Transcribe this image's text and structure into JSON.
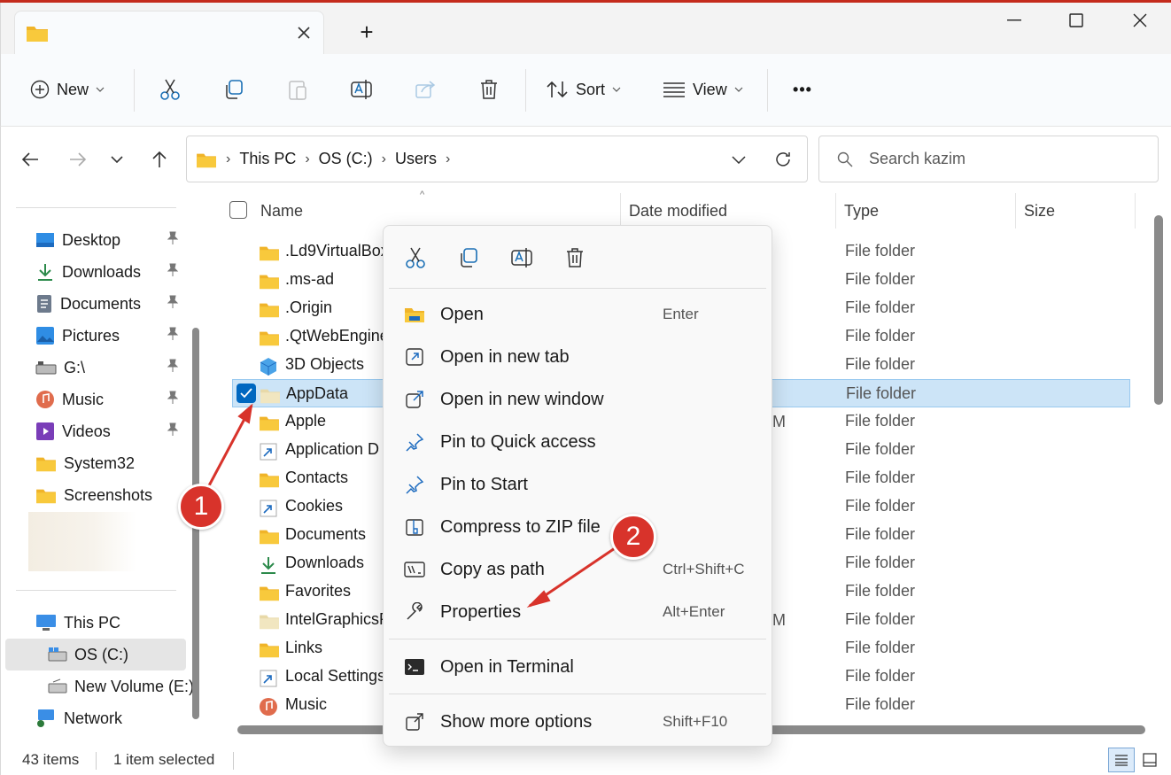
{
  "window": {
    "new_tab_symbol": "+"
  },
  "toolbar": {
    "new_label": "New",
    "sort_label": "Sort",
    "view_label": "View",
    "more_label": "•••"
  },
  "address": {
    "crumbs": [
      "This PC",
      "OS (C:)",
      "Users"
    ]
  },
  "search": {
    "placeholder": "Search kazim"
  },
  "nav": {
    "quick": [
      "Desktop",
      "Downloads",
      "Documents",
      "Pictures",
      "G:\\",
      "Music",
      "Videos",
      "System32",
      "Screenshots"
    ],
    "this_pc": "This PC",
    "drives": [
      "OS (C:)",
      "New Volume (E:)"
    ],
    "network": "Network"
  },
  "columns": {
    "name": "Name",
    "date": "Date modified",
    "type": "Type",
    "size": "Size"
  },
  "files": [
    {
      "name": ".Ld9VirtualBox",
      "type": "File folder"
    },
    {
      "name": ".ms-ad",
      "type": "File folder"
    },
    {
      "name": ".Origin",
      "type": "File folder"
    },
    {
      "name": ".QtWebEngine",
      "type": "File folder"
    },
    {
      "name": "3D Objects",
      "type": "File folder"
    },
    {
      "name": "AppData",
      "type": "File folder"
    },
    {
      "name": "Apple",
      "type": "File folder"
    },
    {
      "name": "Application D",
      "type": "File folder"
    },
    {
      "name": "Contacts",
      "type": "File folder"
    },
    {
      "name": "Cookies",
      "type": "File folder"
    },
    {
      "name": "Documents",
      "type": "File folder"
    },
    {
      "name": "Downloads",
      "type": "File folder"
    },
    {
      "name": "Favorites",
      "type": "File folder"
    },
    {
      "name": "IntelGraphicsP",
      "type": "File folder"
    },
    {
      "name": "Links",
      "type": "File folder"
    },
    {
      "name": "Local Settings",
      "type": "File folder"
    },
    {
      "name": "Music",
      "type": "File folder"
    }
  ],
  "date_fragments": {
    "apple": "M",
    "intel": "M"
  },
  "context_menu": {
    "items": [
      {
        "label": "Open",
        "shortcut": "Enter"
      },
      {
        "label": "Open in new tab",
        "shortcut": ""
      },
      {
        "label": "Open in new window",
        "shortcut": ""
      },
      {
        "label": "Pin to Quick access",
        "shortcut": ""
      },
      {
        "label": "Pin to Start",
        "shortcut": ""
      },
      {
        "label": "Compress to ZIP file",
        "shortcut": ""
      },
      {
        "label": "Copy as path",
        "shortcut": "Ctrl+Shift+C"
      },
      {
        "label": "Properties",
        "shortcut": "Alt+Enter"
      },
      {
        "label": "Open in Terminal",
        "shortcut": ""
      },
      {
        "label": "Show more options",
        "shortcut": "Shift+F10"
      }
    ]
  },
  "annotations": {
    "step1": "1",
    "step2": "2"
  },
  "status": {
    "count": "43 items",
    "selected": "1 item selected"
  },
  "colors": {
    "accent": "#0067c0",
    "selection": "#cce4f7",
    "annotation": "#d8332b",
    "folder": "#f8c93c"
  }
}
